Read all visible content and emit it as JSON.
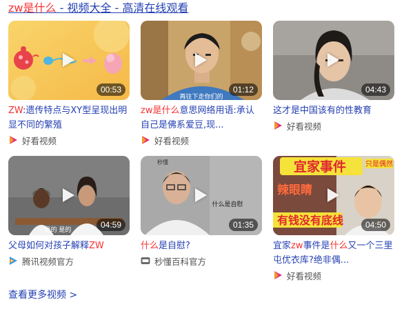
{
  "header": {
    "query_part": "zw是什么",
    "suffix": " - 视频大全 - 高清在线观看"
  },
  "videos": [
    {
      "duration": "00:53",
      "title_hl_1": "ZW",
      "title_1": ":遗传特点与XY型呈现出明显不同的繁殖",
      "source": "好看视频"
    },
    {
      "duration": "01:12",
      "title_hl_1": "zw是什么",
      "title_1": "意思网络用语:承认自己是佛系爱豆,现...",
      "source": "好看视频",
      "overlay_text": "再往下走你们的"
    },
    {
      "duration": "04:43",
      "title_1": "这才是中国该有的性教育",
      "source": "好看视频"
    },
    {
      "duration": "04:59",
      "title_1": "父母如何对孩子解释",
      "title_hl_1": "ZW",
      "source": "腾讯视频官方",
      "overlay_text": "是的 是的"
    },
    {
      "duration": "01:35",
      "title_hl_1": "什么",
      "title_1": "是自慰?",
      "source": "秒懂百科官方",
      "overlay_text": "什么是自慰",
      "corner_text": "秒懂"
    },
    {
      "duration": "04:50",
      "title_1": "宜家",
      "title_hl_1": "zw",
      "title_2": "事件是",
      "title_hl_2": "什么",
      "title_3": "又一个三里屯优衣库?绝非偶...",
      "source": "好看视频",
      "banner_text": "宜家事件",
      "overlay_text_1": "辣眼睛",
      "overlay_text_2": "有钱没有底线",
      "corner_text": "只是偶然"
    }
  ],
  "footer": {
    "more_label": "查看更多视频 >"
  },
  "colors": {
    "link": "#2440b3",
    "highlight": "#f73131",
    "haokan_icon": "#e02c7d",
    "tencent_icon": "#2da0f0"
  },
  "icons": {
    "play": "play-icon",
    "haokan": "haokan-video-icon",
    "tencent": "tencent-video-icon",
    "baike": "miaodong-baike-icon"
  }
}
